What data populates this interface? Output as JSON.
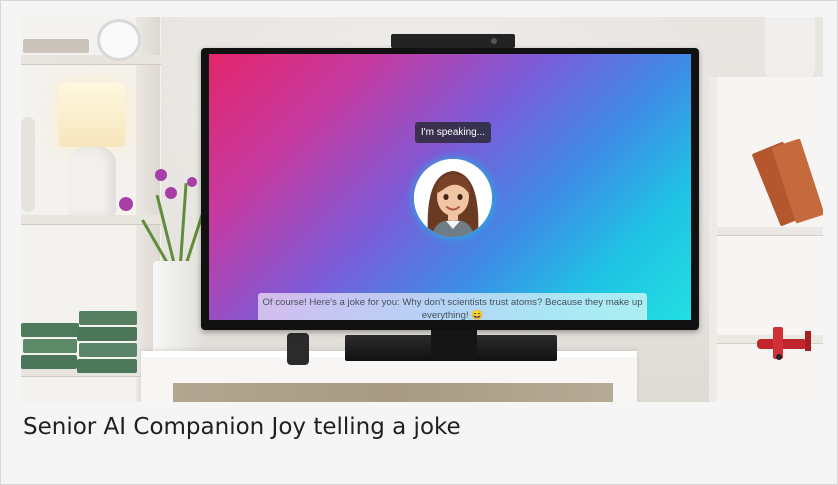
{
  "screen": {
    "status_label": "I'm speaking...",
    "message": "Of course! Here's a joke for you: Why don't scientists trust atoms? Because they make up everything! 😄",
    "avatar_icon": "woman-avatar-icon",
    "colors": {
      "gradient_start": "#e3256b",
      "gradient_mid": "#7c5bd8",
      "gradient_end": "#23dfe0"
    }
  },
  "caption": {
    "text": "Senior AI Companion Joy telling a joke"
  }
}
